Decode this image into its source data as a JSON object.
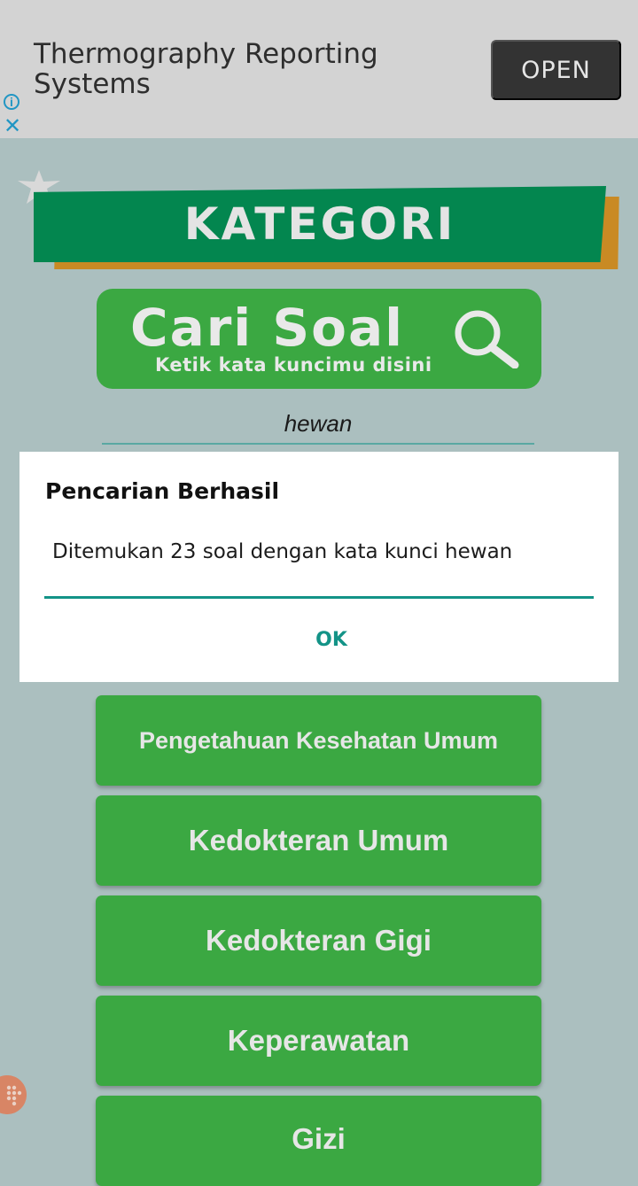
{
  "ad": {
    "title": "Thermography Reporting Systems",
    "open_label": "OPEN",
    "info_icon": "i",
    "close_icon": "✕"
  },
  "header": {
    "title": "KATEGORI"
  },
  "search_banner": {
    "title": "Cari Soal",
    "subtitle": "Ketik kata kuncimu disini"
  },
  "search": {
    "value": "hewan"
  },
  "dialog": {
    "title": "Pencarian Berhasil",
    "message": "Ditemukan 23 soal dengan kata kunci hewan",
    "ok_label": "OK"
  },
  "categories": [
    {
      "label": "Pengetahuan Kesehatan Umum"
    },
    {
      "label": "Kedokteran Umum"
    },
    {
      "label": "Kedokteran Gigi"
    },
    {
      "label": "Keperawatan"
    },
    {
      "label": "Gizi"
    }
  ],
  "colors": {
    "background": "#abbfbf",
    "primary_green": "#3ba842",
    "banner_green": "#03864f",
    "accent_teal": "#139387"
  }
}
